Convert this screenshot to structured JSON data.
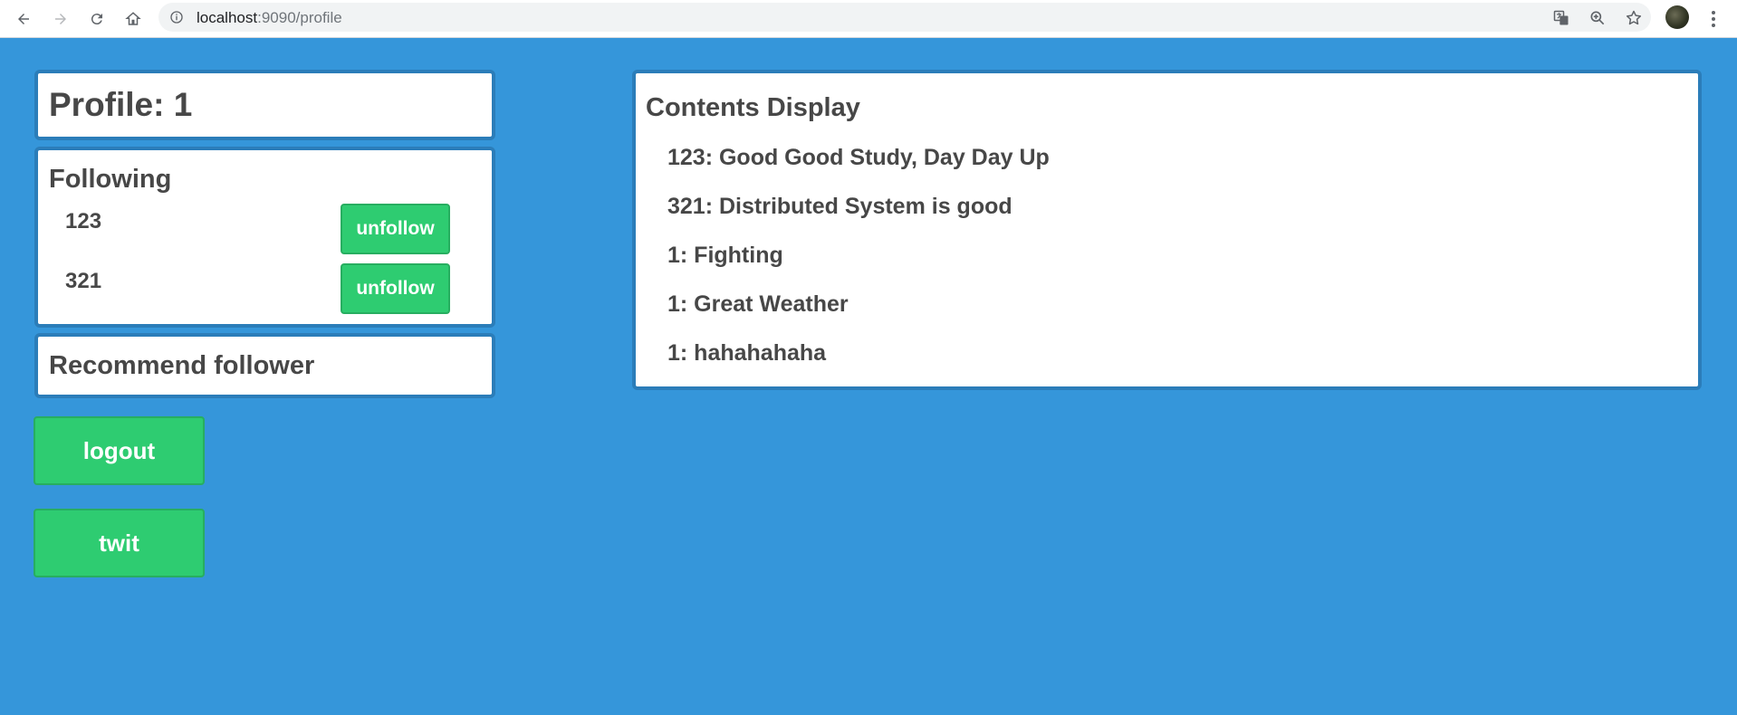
{
  "browser": {
    "url_host": "localhost",
    "url_rest": ":9090/profile"
  },
  "profile": {
    "title": "Profile: 1"
  },
  "following": {
    "title": "Following",
    "items": [
      {
        "name": "123",
        "button_label": "unfollow"
      },
      {
        "name": "321",
        "button_label": "unfollow"
      }
    ]
  },
  "recommend": {
    "title": "Recommend follower"
  },
  "actions": {
    "logout_label": "logout",
    "twit_label": "twit"
  },
  "contents": {
    "title": "Contents Display",
    "items": [
      "123: Good Good Study, Day Day Up",
      "321: Distributed System is good",
      "1: Fighting",
      "1: Great Weather",
      "1: hahahahaha"
    ]
  },
  "colors": {
    "background": "#3596da",
    "panel_border": "#2b7db9",
    "button_green": "#2ecc71",
    "text": "#474747"
  }
}
